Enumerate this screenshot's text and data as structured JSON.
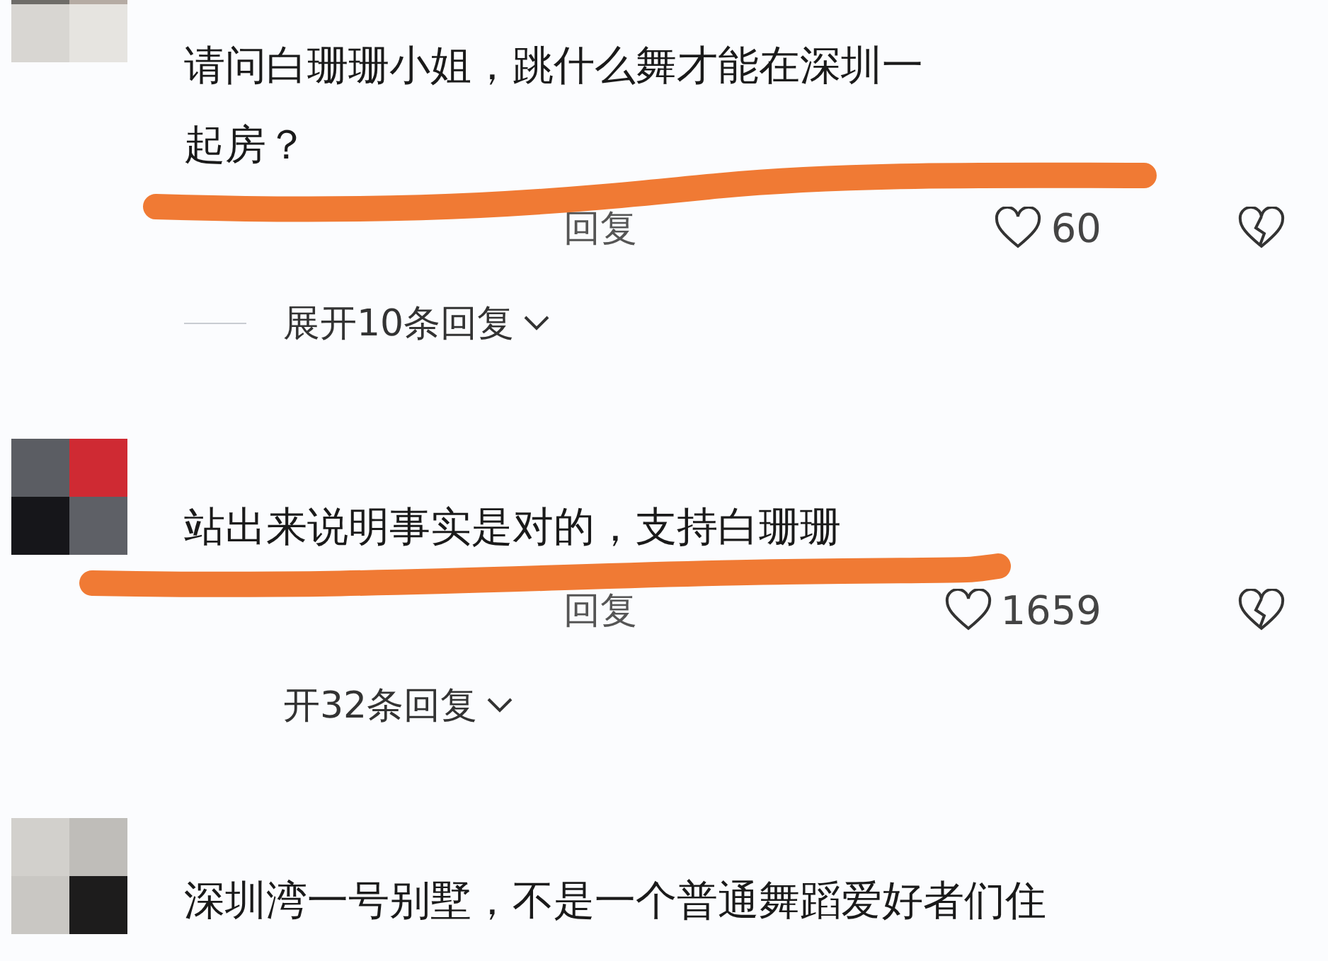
{
  "comments": [
    {
      "text": "请问白珊珊小姐，跳什么舞才能在深圳一",
      "text_2": "起房？",
      "reply": "回复",
      "likes": "60",
      "expand": "展开10条回复",
      "expand_rule": true
    },
    {
      "text": "站出来说明事实是对的，支持白珊珊",
      "reply": "回复",
      "likes": "1659",
      "expand": "开32条回复",
      "expand_rule": false
    },
    {
      "text": "深圳湾一号别墅，不是一个普通舞蹈爱好者们住"
    }
  ]
}
